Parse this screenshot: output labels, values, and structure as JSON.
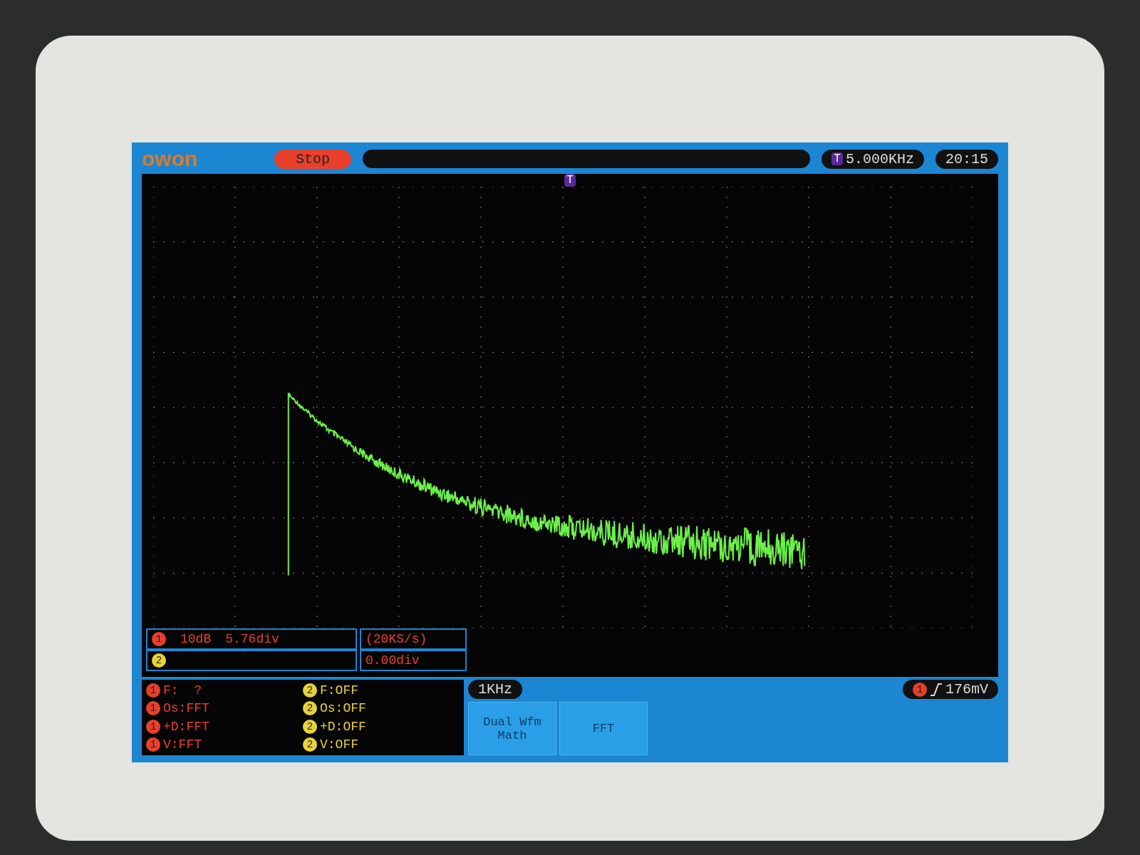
{
  "header": {
    "logo": "owon",
    "run_state": {
      "label": "Stop",
      "running": false
    },
    "trigger_marker": "T",
    "trigger_frequency": "5.000KHz",
    "clock": "20:15"
  },
  "plot": {
    "trigger_marker": "T"
  },
  "channel_info": [
    {
      "channel": "1",
      "color": "#e8402a",
      "scale": "10dB",
      "position": "5.76div"
    },
    {
      "channel": "2",
      "color": "#e8d23a"
    }
  ],
  "timebase": {
    "rate": "(20KS/s)",
    "offset": "0.00div"
  },
  "measurements": [
    {
      "channel": "1",
      "color": "#e8402a",
      "text": "F:  ?"
    },
    {
      "channel": "1",
      "color": "#e8402a",
      "text": "Os:FFT"
    },
    {
      "channel": "1",
      "color": "#e8402a",
      "text": "+D:FFT"
    },
    {
      "channel": "1",
      "color": "#e8402a",
      "text": "V:FFT"
    },
    {
      "channel": "2",
      "color": "#e8d23a",
      "text": "F:OFF"
    },
    {
      "channel": "2",
      "color": "#e8d23a",
      "text": "Os:OFF"
    },
    {
      "channel": "2",
      "color": "#e8d23a",
      "text": "+D:OFF"
    },
    {
      "channel": "2",
      "color": "#e8d23a",
      "text": "V:OFF"
    }
  ],
  "frequency_scale": "1KHz",
  "menu": [
    {
      "label": "Dual Wfm Math"
    },
    {
      "label": "FFT"
    }
  ],
  "trigger": {
    "channel": "1",
    "color": "#e8402a",
    "level": "176mV"
  }
}
